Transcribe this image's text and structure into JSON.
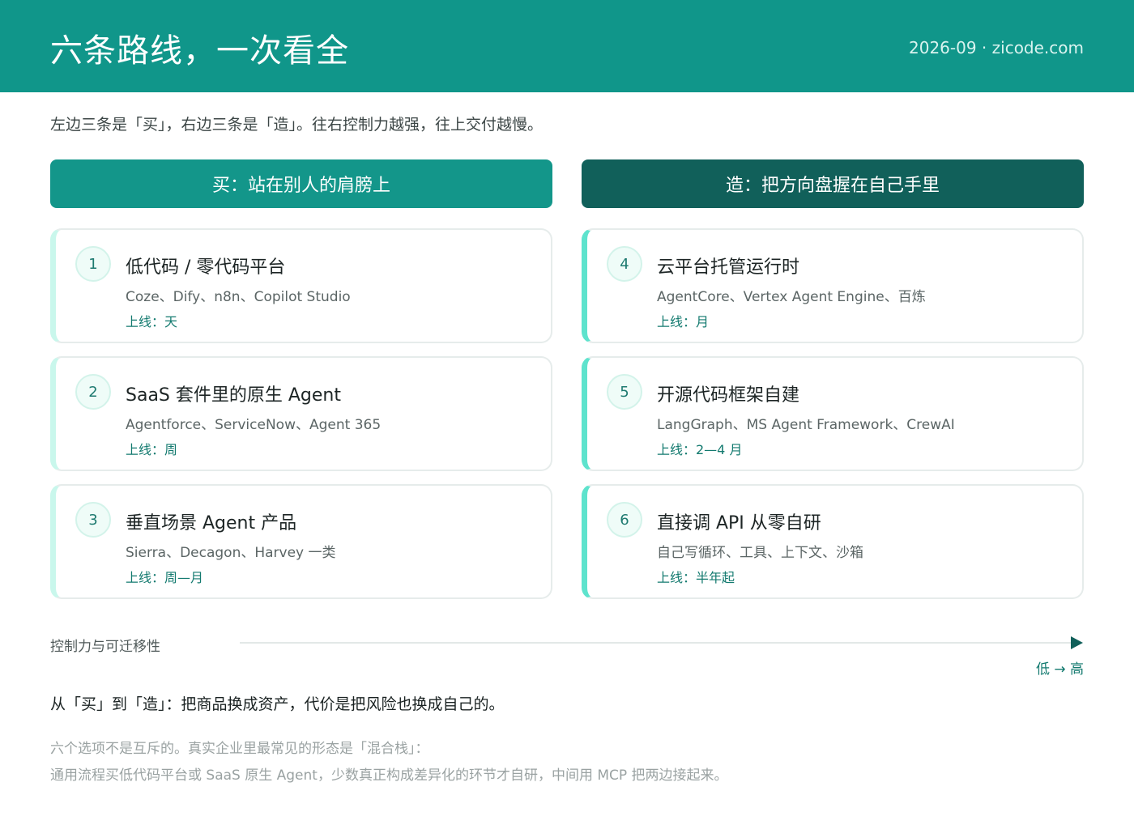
{
  "header": {
    "title": "六条路线，一次看全",
    "meta": "2026-09 · zicode.com"
  },
  "intro": "左边三条是「买」，右边三条是「造」。往右控制力越强，往上交付越慢。",
  "columns": {
    "buy": {
      "label": "买：站在别人的肩膀上"
    },
    "build": {
      "label": "造：把方向盘握在自己手里"
    }
  },
  "cards": [
    {
      "num": "1",
      "title": "低代码 / 零代码平台",
      "examples": "Coze、Dify、n8n、Copilot Studio",
      "launch": "上线：天"
    },
    {
      "num": "2",
      "title": "SaaS 套件里的原生 Agent",
      "examples": "Agentforce、ServiceNow、Agent 365",
      "launch": "上线：周"
    },
    {
      "num": "3",
      "title": "垂直场景 Agent 产品",
      "examples": "Sierra、Decagon、Harvey 一类",
      "launch": "上线：周—月"
    },
    {
      "num": "4",
      "title": "云平台托管运行时",
      "examples": "AgentCore、Vertex Agent Engine、百炼",
      "launch": "上线：月"
    },
    {
      "num": "5",
      "title": "开源代码框架自建",
      "examples": "LangGraph、MS Agent Framework、CrewAI",
      "launch": "上线：2—4 月"
    },
    {
      "num": "6",
      "title": "直接调 API 从零自研",
      "examples": "自己写循环、工具、上下文、沙箱",
      "launch": "上线：半年起"
    }
  ],
  "axis": {
    "label": "控制力与可迁移性",
    "range": "低 → 高"
  },
  "summary": "从「买」到「造」：把商品换成资产，代价是把风险也换成自己的。",
  "notes": [
    "六个选项不是互斥的。真实企业里最常见的形态是「混合栈」：",
    "通用流程买低代码平台或 SaaS 原生 Agent，少数真正构成差异化的环节才自研，中间用 MCP 把两边接起来。"
  ],
  "colors": {
    "header_bg": "#10968a",
    "buy_head": "#13968a",
    "build_head": "#11605a",
    "accent_text": "#137a6f"
  }
}
